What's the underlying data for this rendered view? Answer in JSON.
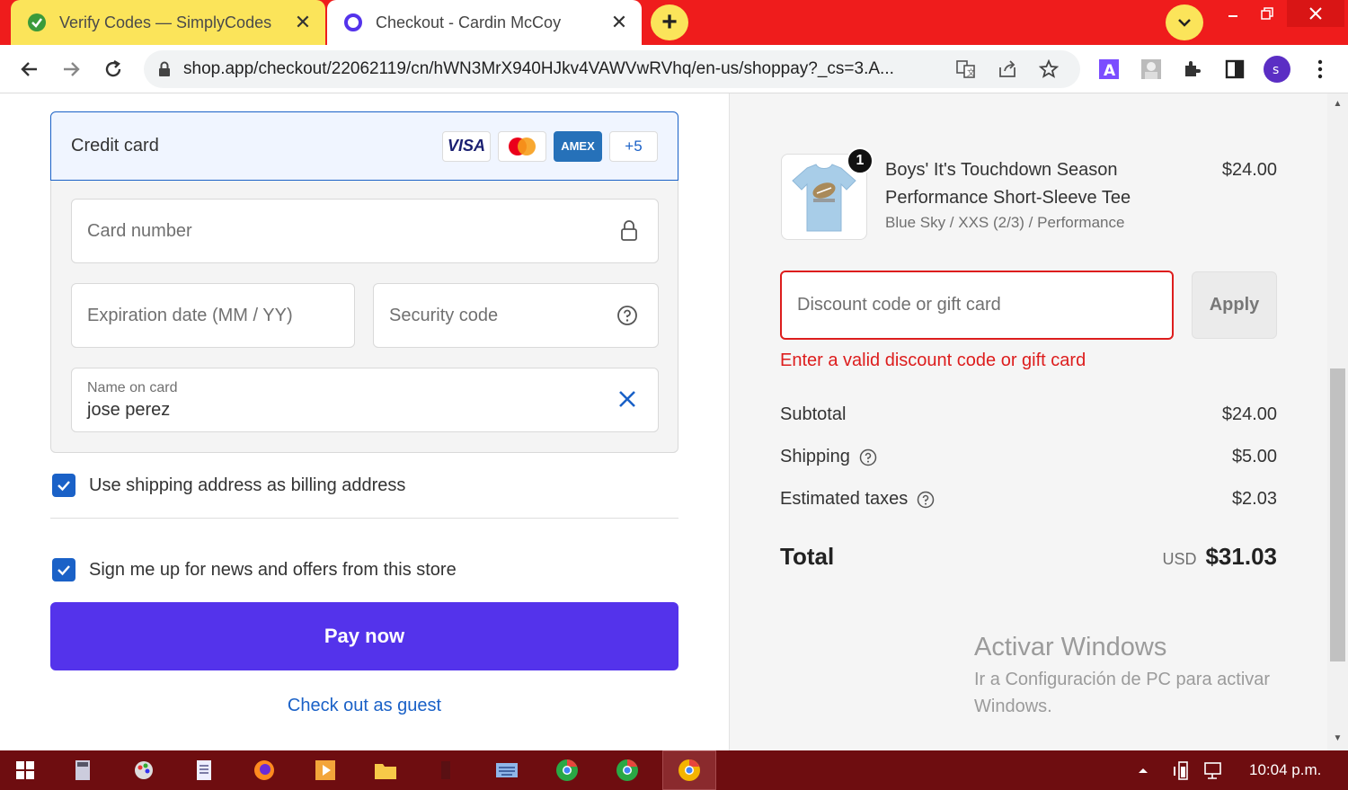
{
  "browser": {
    "tabs": [
      {
        "title": "Verify Codes — SimplyCodes",
        "close": "✕"
      },
      {
        "title": "Checkout - Cardin McCoy",
        "close": "✕"
      }
    ],
    "new_tab": "+",
    "url": "shop.app/checkout/22062119/cn/hWN3MrX940HJkv4VAWVwRVhq/en-us/shoppay?_cs=3.A..."
  },
  "payment": {
    "method_label": "Credit card",
    "brands": [
      "VISA",
      "AMEX",
      "+5"
    ],
    "card_number_placeholder": "Card number",
    "expiration_placeholder": "Expiration date (MM / YY)",
    "security_placeholder": "Security code",
    "name_label": "Name on card",
    "name_value": "jose perez"
  },
  "options": {
    "billing_same": "Use shipping address as billing address",
    "newsletter": "Sign me up for news and offers from this store"
  },
  "actions": {
    "pay_now": "Pay now",
    "guest": "Check out as guest"
  },
  "summary": {
    "product": {
      "quantity": "1",
      "name": "Boys' It's Touchdown Season Performance Short-Sleeve Tee",
      "variant": "Blue Sky / XXS (2/3) / Performance",
      "price": "$24.00"
    },
    "discount_placeholder": "Discount code or gift card",
    "apply": "Apply",
    "error": "Enter a valid discount code or gift card",
    "subtotal_label": "Subtotal",
    "subtotal": "$24.00",
    "shipping_label": "Shipping",
    "shipping": "$5.00",
    "taxes_label": "Estimated taxes",
    "taxes": "$2.03",
    "total_label": "Total",
    "currency": "USD",
    "total": "$31.03"
  },
  "watermark": {
    "title": "Activar Windows",
    "subtitle": "Ir a Configuración de PC para activar Windows."
  },
  "taskbar": {
    "clock": "10:04 p.m."
  },
  "colors": {
    "accent": "#5433eb",
    "link": "#1a61c7",
    "error": "#dd1d1d",
    "tabbar": "#ef1c1c"
  }
}
